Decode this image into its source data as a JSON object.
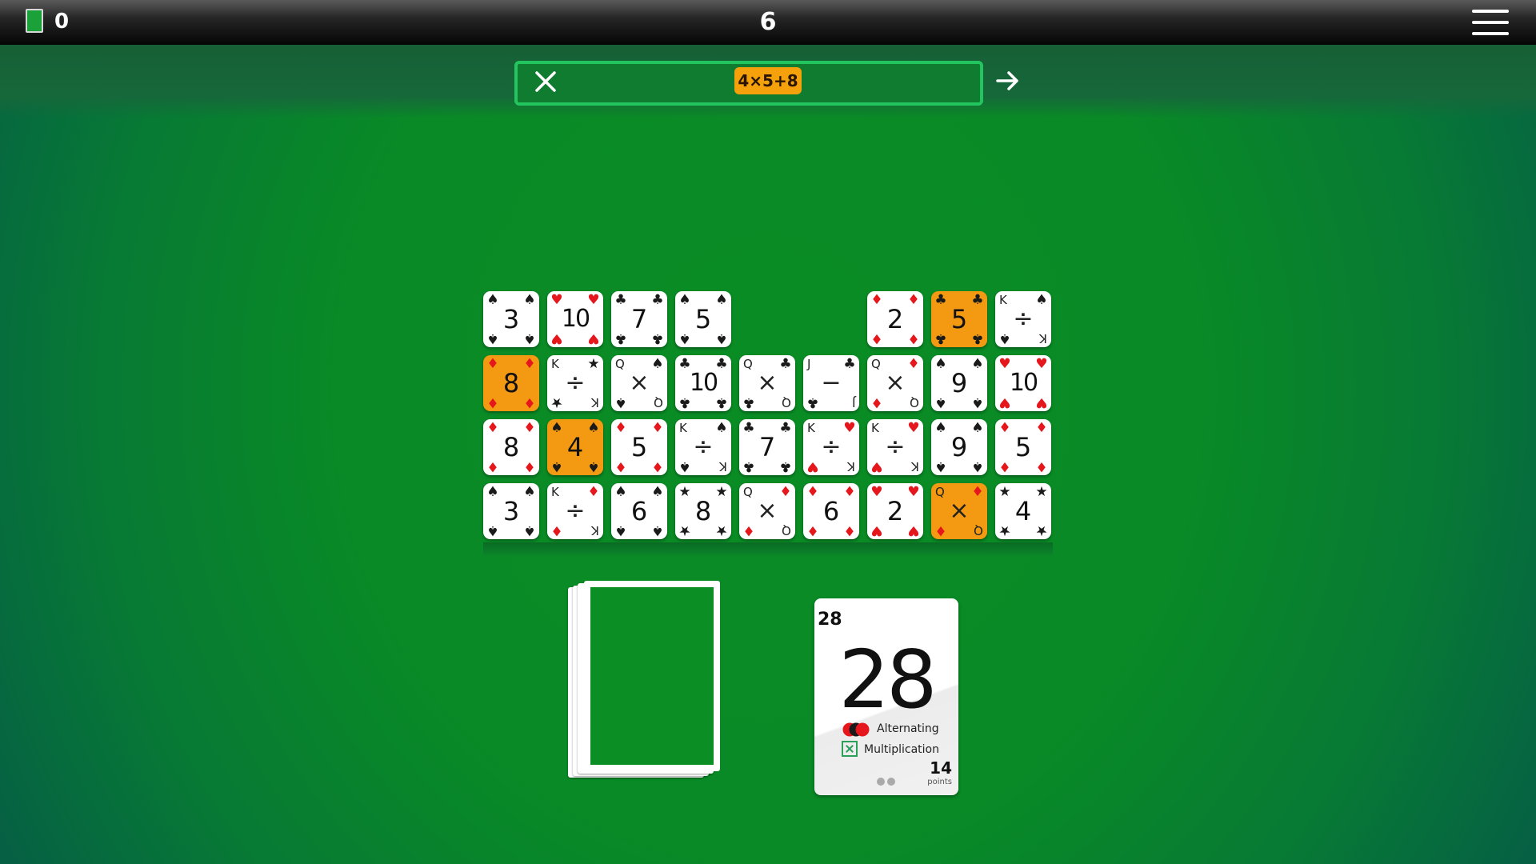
{
  "top_bar": {
    "deck_count": "0",
    "round": "6",
    "icons": {
      "deck": "deck-icon",
      "menu": "hamburger-menu-icon"
    }
  },
  "expression_bar": {
    "expression": "4×5+8",
    "clear_icon": "close-icon",
    "submit_icon": "arrow-right-icon",
    "colors": {
      "border": "#22c55e",
      "pill": "#f5a10b"
    }
  },
  "grid": {
    "rows": [
      [
        {
          "type": "num",
          "value": "3",
          "suit": "♠",
          "color": "blk",
          "hl": false
        },
        {
          "type": "num",
          "value": "10",
          "suit": "♥",
          "color": "red",
          "hl": false
        },
        {
          "type": "num",
          "value": "7",
          "suit": "♣",
          "color": "blk",
          "hl": false
        },
        {
          "type": "num",
          "value": "5",
          "suit": "♠",
          "color": "blk",
          "hl": false
        },
        null,
        null,
        {
          "type": "num",
          "value": "2",
          "suit": "♦",
          "color": "red",
          "hl": false
        },
        {
          "type": "num",
          "value": "5",
          "suit": "♣",
          "color": "blk",
          "hl": true
        },
        {
          "type": "face",
          "rank": "K",
          "op": "÷",
          "suit": "♠",
          "color": "blk",
          "hl": false
        }
      ],
      [
        {
          "type": "num",
          "value": "8",
          "suit": "♦",
          "color": "red",
          "hl": true
        },
        {
          "type": "face",
          "rank": "K",
          "op": "÷",
          "suit": "★",
          "color": "blk",
          "hl": false
        },
        {
          "type": "face",
          "rank": "Q",
          "op": "×",
          "suit": "♠",
          "color": "blk",
          "hl": false
        },
        {
          "type": "num",
          "value": "10",
          "suit": "♣",
          "color": "blk",
          "hl": false
        },
        {
          "type": "face",
          "rank": "Q",
          "op": "×",
          "suit": "♣",
          "color": "blk",
          "hl": false
        },
        {
          "type": "face",
          "rank": "J",
          "op": "−",
          "suit": "♣",
          "color": "blk",
          "hl": false
        },
        {
          "type": "face",
          "rank": "Q",
          "op": "×",
          "suit": "♦",
          "color": "red",
          "hl": false
        },
        {
          "type": "num",
          "value": "9",
          "suit": "♠",
          "color": "blk",
          "hl": false
        },
        {
          "type": "num",
          "value": "10",
          "suit": "♥",
          "color": "red",
          "hl": false
        }
      ],
      [
        {
          "type": "num",
          "value": "8",
          "suit": "♦",
          "color": "red",
          "hl": false
        },
        {
          "type": "num",
          "value": "4",
          "suit": "♠",
          "color": "blk",
          "hl": true
        },
        {
          "type": "num",
          "value": "5",
          "suit": "♦",
          "color": "red",
          "hl": false
        },
        {
          "type": "face",
          "rank": "K",
          "op": "÷",
          "suit": "♠",
          "color": "blk",
          "hl": false
        },
        {
          "type": "num",
          "value": "7",
          "suit": "♣",
          "color": "blk",
          "hl": false
        },
        {
          "type": "face",
          "rank": "K",
          "op": "÷",
          "suit": "♥",
          "color": "red",
          "hl": false
        },
        {
          "type": "face",
          "rank": "K",
          "op": "÷",
          "suit": "♥",
          "color": "red",
          "hl": false
        },
        {
          "type": "num",
          "value": "9",
          "suit": "♠",
          "color": "blk",
          "hl": false
        },
        {
          "type": "num",
          "value": "5",
          "suit": "♦",
          "color": "red",
          "hl": false
        }
      ],
      [
        {
          "type": "num",
          "value": "3",
          "suit": "♠",
          "color": "blk",
          "hl": false
        },
        {
          "type": "face",
          "rank": "K",
          "op": "÷",
          "suit": "♦",
          "color": "red",
          "hl": false
        },
        {
          "type": "num",
          "value": "6",
          "suit": "♠",
          "color": "blk",
          "hl": false
        },
        {
          "type": "num",
          "value": "8",
          "suit": "★",
          "color": "blk",
          "hl": false
        },
        {
          "type": "face",
          "rank": "Q",
          "op": "×",
          "suit": "♦",
          "color": "red",
          "hl": false
        },
        {
          "type": "num",
          "value": "6",
          "suit": "♦",
          "color": "red",
          "hl": false
        },
        {
          "type": "num",
          "value": "2",
          "suit": "♥",
          "color": "red",
          "hl": false
        },
        {
          "type": "face",
          "rank": "Q",
          "op": "×",
          "suit": "♦",
          "color": "red",
          "hl": true
        },
        {
          "type": "num",
          "value": "4",
          "suit": "★",
          "color": "blk",
          "hl": false
        }
      ]
    ],
    "highlight_color": "#f39a12"
  },
  "target_card": {
    "corner_value": "28",
    "value": "28",
    "rule_1": "Alternating",
    "rule_2": "Multiplication",
    "points": "14",
    "points_label": "points",
    "icons": {
      "rule_1": "red-black-dots-icon",
      "rule_2": "multiply-box-icon"
    }
  }
}
